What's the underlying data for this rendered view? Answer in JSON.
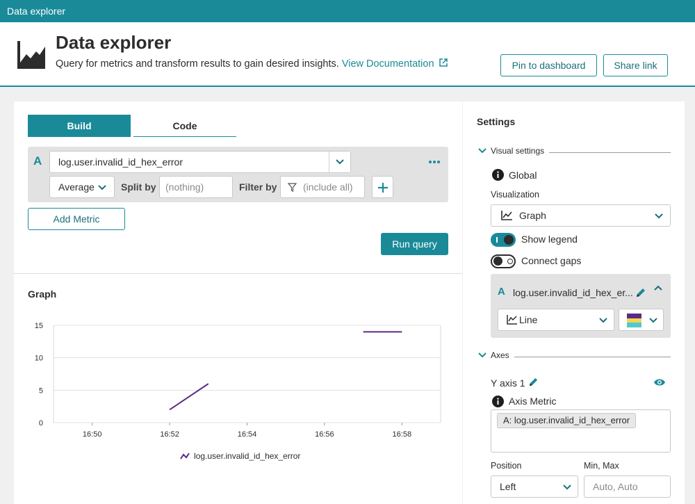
{
  "topbar": {
    "title": "Data explorer"
  },
  "header": {
    "title": "Data explorer",
    "subtitle": "Query for metrics and transform results to gain desired insights.",
    "doc_link": "View Documentation",
    "pin_button": "Pin to dashboard",
    "share_button": "Share link"
  },
  "query": {
    "tabs": [
      {
        "label": "Build"
      },
      {
        "label": "Code"
      }
    ],
    "letter": "A",
    "metric": "log.user.invalid_id_hex_error",
    "aggregation": "Average",
    "split_label": "Split by",
    "split_placeholder": "(nothing)",
    "filter_label": "Filter by",
    "filter_placeholder": "(include all)",
    "add_metric": "Add Metric",
    "run_query": "Run query"
  },
  "graph": {
    "title": "Graph"
  },
  "settings": {
    "title": "Settings",
    "visual_section": "Visual settings",
    "global_label": "Global",
    "visualization_label": "Visualization",
    "visualization_value": "Graph",
    "show_legend": "Show legend",
    "show_legend_on": true,
    "connect_gaps": "Connect gaps",
    "connect_gaps_on": false,
    "metric_letter": "A",
    "metric_name": "log.user.invalid_id_hex_er...",
    "line_type": "Line",
    "palette": [
      "#5b2a86",
      "#f5d54e",
      "#4fc9cf"
    ],
    "axes_section": "Axes",
    "y_axis": "Y axis 1",
    "axis_metric_label": "Axis Metric",
    "axis_metric_tag": "A: log.user.invalid_id_hex_error",
    "position_label": "Position",
    "position_value": "Left",
    "minmax_label": "Min, Max",
    "minmax_placeholder": "Auto, Auto"
  },
  "chart_data": {
    "type": "line",
    "x_ticks": [
      "16:50",
      "16:52",
      "16:54",
      "16:56",
      "16:58"
    ],
    "y_ticks": [
      0,
      5,
      10,
      15
    ],
    "ylim": [
      0,
      15
    ],
    "xlim_minutes": [
      "16:49",
      "16:59"
    ],
    "series": [
      {
        "name": "log.user.invalid_id_hex_error",
        "color": "#5b2a86",
        "segments": [
          [
            {
              "x": "16:52",
              "y": 2
            },
            {
              "x": "16:53",
              "y": 6
            }
          ],
          [
            {
              "x": "16:57",
              "y": 14
            },
            {
              "x": "16:58",
              "y": 14
            }
          ]
        ]
      }
    ],
    "legend": "bottom-center",
    "grid": true
  }
}
